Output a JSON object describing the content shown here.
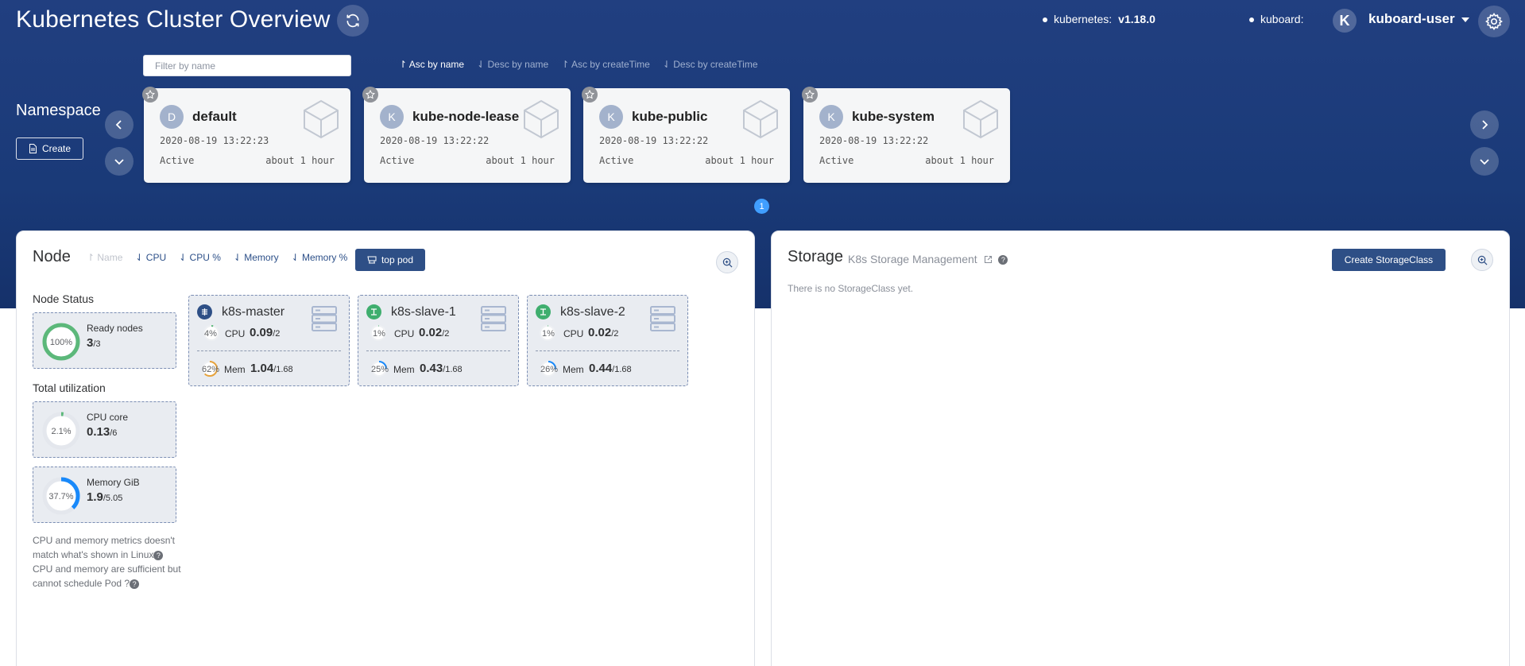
{
  "header": {
    "title": "Kubernetes Cluster Overview",
    "kubernetes_label": "kubernetes:",
    "kubernetes_version": "v1.18.0",
    "kuboard_label": "kuboard:",
    "avatar_letter": "K",
    "user": "kuboard-user"
  },
  "namespace": {
    "filter_placeholder": "Filter by name",
    "sort_options": [
      "Asc by name",
      "Desc by name",
      "Asc by createTime",
      "Desc by createTime"
    ],
    "active_sort": "Asc by name",
    "section_title": "Namespace",
    "create_label": "Create",
    "cards": [
      {
        "letter": "D",
        "name": "default",
        "created": "2020-08-19 13:22:23",
        "status": "Active",
        "age": "about 1 hour"
      },
      {
        "letter": "K",
        "name": "kube-node-lease",
        "created": "2020-08-19 13:22:22",
        "status": "Active",
        "age": "about 1 hour"
      },
      {
        "letter": "K",
        "name": "kube-public",
        "created": "2020-08-19 13:22:22",
        "status": "Active",
        "age": "about 1 hour"
      },
      {
        "letter": "K",
        "name": "kube-system",
        "created": "2020-08-19 13:22:22",
        "status": "Active",
        "age": "about 1 hour"
      }
    ],
    "page": "1"
  },
  "node": {
    "title": "Node",
    "sort_options": [
      "Name",
      "CPU",
      "CPU %",
      "Memory",
      "Memory %"
    ],
    "top_pod_label": "top pod",
    "status_title": "Node Status",
    "ready": {
      "pct_text": "100%",
      "fraction": 1.0,
      "label": "Ready nodes",
      "value": "3",
      "total": "/3"
    },
    "utilization_title": "Total utilization",
    "cpu_total": {
      "pct_text": "2.1%",
      "fraction": 0.021,
      "label": "CPU core",
      "value": "0.13",
      "total": "/6"
    },
    "mem_total": {
      "pct_text": "37.7%",
      "fraction": 0.377,
      "label": "Memory GiB",
      "value": "1.9",
      "total": "/5.05"
    },
    "note1": "CPU and memory metrics doesn't match what's shown in Linux",
    "note2": "CPU and memory are sufficient but cannot schedule Pod ?",
    "nodes": [
      {
        "name": "k8s-master",
        "role": "master",
        "cpu_pct": "4%",
        "cpu_frac": 0.04,
        "cpu_label": "CPU",
        "cpu": "0.09",
        "cpu_total": "/2",
        "mem_pct": "62%",
        "mem_frac": 0.62,
        "mem_label": "Mem",
        "mem": "1.04",
        "mem_total": "/1.68"
      },
      {
        "name": "k8s-slave-1",
        "role": "worker",
        "cpu_pct": "1%",
        "cpu_frac": 0.01,
        "cpu_label": "CPU",
        "cpu": "0.02",
        "cpu_total": "/2",
        "mem_pct": "25%",
        "mem_frac": 0.25,
        "mem_label": "Mem",
        "mem": "0.43",
        "mem_total": "/1.68"
      },
      {
        "name": "k8s-slave-2",
        "role": "worker",
        "cpu_pct": "1%",
        "cpu_frac": 0.01,
        "cpu_label": "CPU",
        "cpu": "0.02",
        "cpu_total": "/2",
        "mem_pct": "26%",
        "mem_frac": 0.26,
        "mem_label": "Mem",
        "mem": "0.44",
        "mem_total": "/1.68"
      }
    ]
  },
  "storage": {
    "title": "Storage",
    "subtitle": "K8s Storage Management",
    "create_label": "Create StorageClass",
    "empty_text": "There is no StorageClass yet."
  },
  "colors": {
    "banner": "#1e3d7b",
    "primary": "#2e4f86",
    "ok": "#5cb87a",
    "mem": "#1989fa",
    "warn": "#e6a23c",
    "pager": "#409eff"
  }
}
